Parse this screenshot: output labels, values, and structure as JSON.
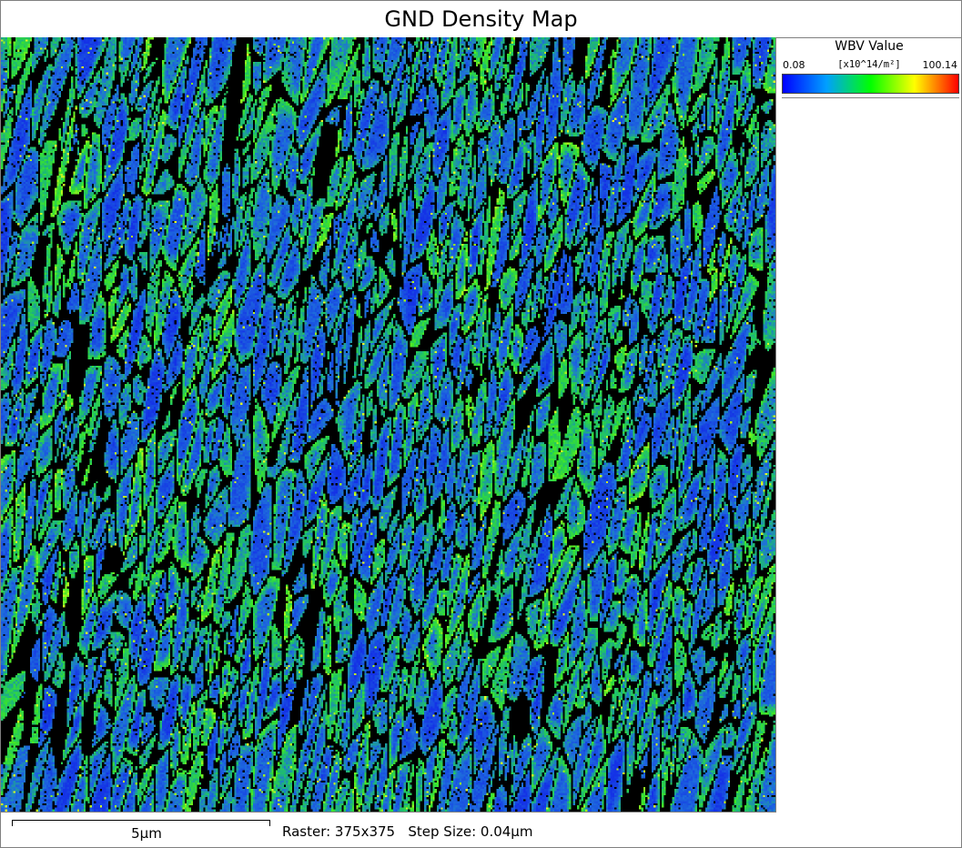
{
  "title": "GND Density Map",
  "legend": {
    "title": "WBV Value",
    "min": "0.08",
    "unit": "[x10^14/m²]",
    "max": "100.14",
    "colormap": [
      "#0000ff",
      "#00a0ff",
      "#00ff00",
      "#ffff00",
      "#ff0000"
    ]
  },
  "footer": {
    "scale_label": "5μm",
    "info": "Raster: 375x375   Step Size: 0.04μm"
  },
  "map": {
    "description_colors": {
      "low": "#1a50e0",
      "mid": "#22c060",
      "high": "#a8f020",
      "boundary": "#000000"
    }
  }
}
